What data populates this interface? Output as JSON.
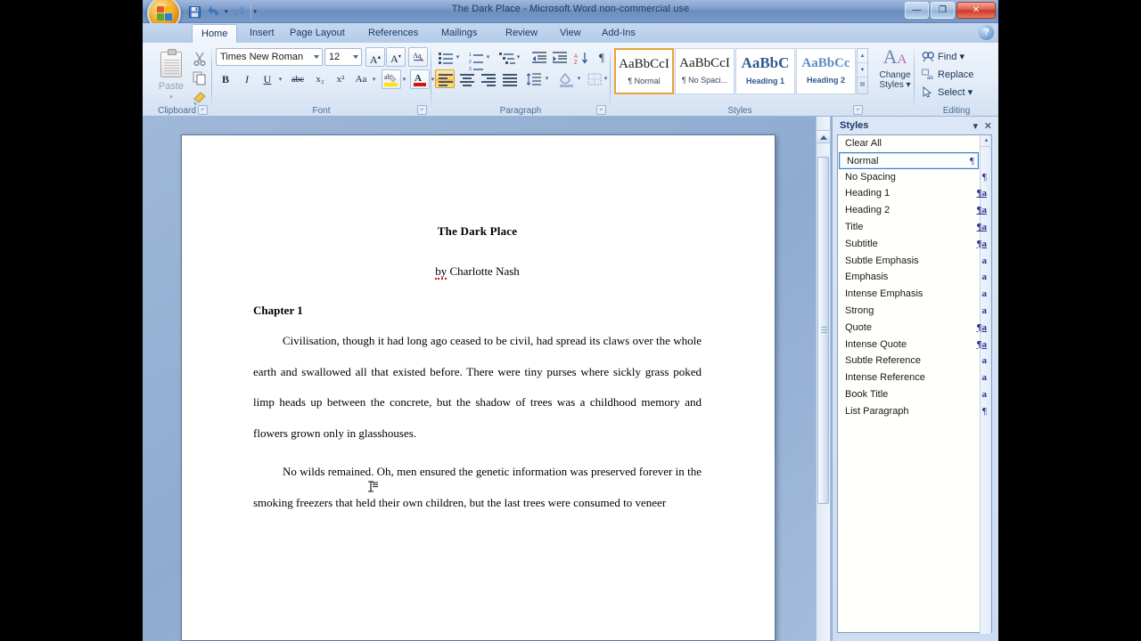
{
  "window": {
    "title": "The Dark Place - Microsoft Word non-commercial use",
    "minimize_label": "—",
    "restore_label": "❐",
    "close_label": "✕",
    "help_label": "?"
  },
  "quick_access": {
    "office_button": "office-orb",
    "items": [
      {
        "name": "save",
        "glyph": "save-icon"
      },
      {
        "name": "undo",
        "glyph": "undo-icon"
      },
      {
        "name": "redo",
        "glyph": "redo-icon"
      },
      {
        "name": "customize",
        "glyph": "chevron-down-icon"
      }
    ]
  },
  "ribbon": {
    "tabs": [
      {
        "label": "Home",
        "active": true
      },
      {
        "label": "Insert",
        "active": false
      },
      {
        "label": "Page Layout",
        "active": false
      },
      {
        "label": "References",
        "active": false
      },
      {
        "label": "Mailings",
        "active": false
      },
      {
        "label": "Review",
        "active": false
      },
      {
        "label": "View",
        "active": false
      },
      {
        "label": "Add-Ins",
        "active": false
      }
    ],
    "groups": {
      "clipboard": {
        "label": "Clipboard",
        "paste_label": "Paste",
        "paste_caret": "▾",
        "cut_label": "Cut",
        "copy_label": "Copy",
        "format_painter_label": "Format Painter"
      },
      "font": {
        "label": "Font",
        "font_name": "Times New Roman",
        "font_size": "12",
        "grow_font": "A",
        "shrink_font": "A",
        "clear_formatting": "Aa",
        "bold": "B",
        "italic": "I",
        "underline": "U",
        "strikethrough": "abc",
        "subscript": "x₂",
        "superscript": "x²",
        "change_case": "Aa",
        "highlight": "ab",
        "font_color": "A",
        "bold_active": true
      },
      "paragraph": {
        "label": "Paragraph",
        "align_left_active": true
      },
      "styles": {
        "label": "Styles",
        "gallery": [
          {
            "sample": "AaBbCcI",
            "name": "¶ Normal",
            "selected": true
          },
          {
            "sample": "AaBbCcI",
            "name": "¶ No Spaci...",
            "selected": false
          },
          {
            "sample": "AaBbC",
            "name": "Heading 1",
            "selected": false
          },
          {
            "sample": "AaBbCc",
            "name": "Heading 2",
            "selected": false
          }
        ],
        "change_styles_line1": "Change",
        "change_styles_line2": "Styles ▾"
      },
      "editing": {
        "label": "Editing",
        "find": "Find ▾",
        "replace": "Replace",
        "select": "Select ▾"
      }
    }
  },
  "styles_pane": {
    "title": "Styles",
    "options_label": "▾",
    "close_label": "✕",
    "clear_all": "Clear All",
    "items": [
      {
        "label": "Normal",
        "mark": "¶",
        "mark_type": "paragraph",
        "selected": true
      },
      {
        "label": "No Spacing",
        "mark": "¶",
        "mark_type": "paragraph",
        "selected": false
      },
      {
        "label": "Heading 1",
        "mark": "¶a",
        "mark_type": "linked",
        "selected": false
      },
      {
        "label": "Heading 2",
        "mark": "¶a",
        "mark_type": "linked",
        "selected": false
      },
      {
        "label": "Title",
        "mark": "¶a",
        "mark_type": "linked",
        "selected": false
      },
      {
        "label": "Subtitle",
        "mark": "¶a",
        "mark_type": "linked",
        "selected": false
      },
      {
        "label": "Subtle Emphasis",
        "mark": "a",
        "mark_type": "character",
        "selected": false
      },
      {
        "label": "Emphasis",
        "mark": "a",
        "mark_type": "character",
        "selected": false
      },
      {
        "label": "Intense Emphasis",
        "mark": "a",
        "mark_type": "character",
        "selected": false
      },
      {
        "label": "Strong",
        "mark": "a",
        "mark_type": "character",
        "selected": false
      },
      {
        "label": "Quote",
        "mark": "¶a",
        "mark_type": "linked",
        "selected": false
      },
      {
        "label": "Intense Quote",
        "mark": "¶a",
        "mark_type": "linked",
        "selected": false
      },
      {
        "label": "Subtle Reference",
        "mark": "a",
        "mark_type": "character",
        "selected": false
      },
      {
        "label": "Intense Reference",
        "mark": "a",
        "mark_type": "character",
        "selected": false
      },
      {
        "label": "Book Title",
        "mark": "a",
        "mark_type": "character",
        "selected": false
      },
      {
        "label": "List Paragraph",
        "mark": "¶",
        "mark_type": "paragraph",
        "selected": false
      }
    ]
  },
  "document": {
    "title": "The Dark Place",
    "byline_prefix": "by",
    "byline_author": " Charlotte Nash",
    "chapter": "Chapter 1",
    "paragraph_1": "Civilisation, though it had long ago ceased to be civil, had spread its claws over the whole earth and swallowed all that existed before. There were tiny purses where sickly grass poked limp heads up between the concrete, but the shadow of trees was a childhood memory and flowers grown only in glasshouses.",
    "paragraph_2": "No wilds remained. Oh, men ensured the genetic information was preserved forever in the smoking freezers that held their own children, but the last trees were consumed to veneer"
  },
  "colors": {
    "accent_orange": "#ffcf68",
    "titlebar_blue": "#7f9fcc",
    "close_red": "#c93a24",
    "workspace_blue": "#8fabd0",
    "style_mark_blue": "#2b2f8c",
    "spelling_error_red": "#d01010"
  }
}
